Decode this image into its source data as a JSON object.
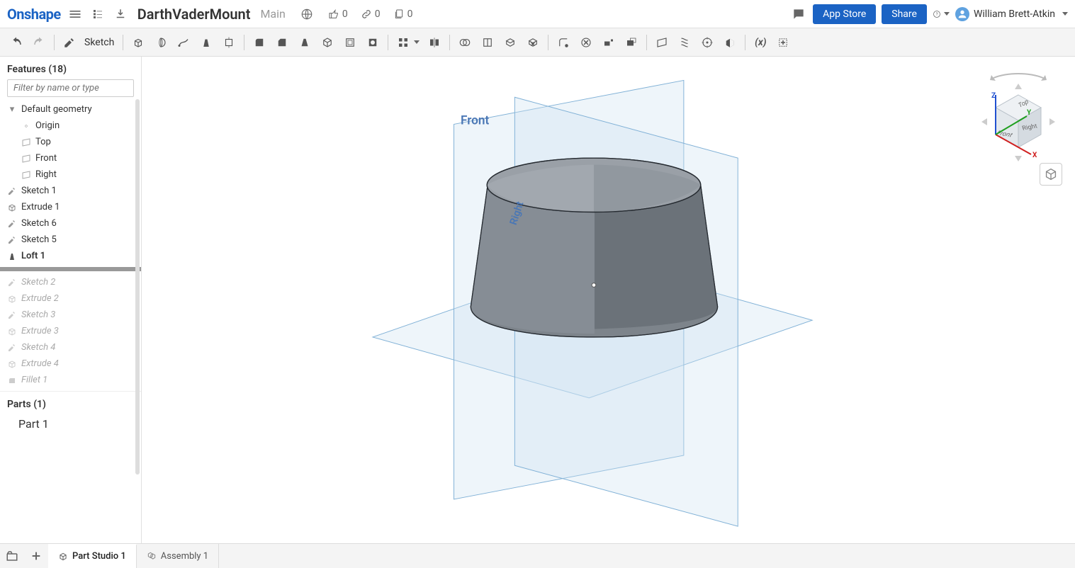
{
  "header": {
    "logo": "Onshape",
    "doc_name": "DarthVaderMount",
    "branch": "Main",
    "likes": "0",
    "links": "0",
    "copies": "0",
    "app_store": "App Store",
    "share": "Share",
    "user": "William Brett-Atkin"
  },
  "toolbar": {
    "sketch_label": "Sketch"
  },
  "sidebar": {
    "features_header": "Features (18)",
    "filter_placeholder": "Filter by name or type",
    "default_geometry": "Default geometry",
    "tree": {
      "origin": "Origin",
      "top": "Top",
      "front": "Front",
      "right": "Right",
      "sketch1": "Sketch 1",
      "extrude1": "Extrude 1",
      "sketch6": "Sketch 6",
      "sketch5": "Sketch 5",
      "loft1": "Loft 1",
      "sketch2": "Sketch 2",
      "extrude2": "Extrude 2",
      "sketch3": "Sketch 3",
      "extrude3": "Extrude 3",
      "sketch4": "Sketch 4",
      "extrude4": "Extrude 4",
      "fillet1": "Fillet 1"
    },
    "parts_header": "Parts (1)",
    "part1": "Part 1"
  },
  "canvas": {
    "front_label": "Front",
    "right_label": "Right",
    "cube_top": "Top",
    "cube_front": "Front",
    "cube_right": "Right",
    "axis_x": "X",
    "axis_y": "Y",
    "axis_z": "Z"
  },
  "footer": {
    "tab1": "Part Studio 1",
    "tab2": "Assembly 1"
  }
}
